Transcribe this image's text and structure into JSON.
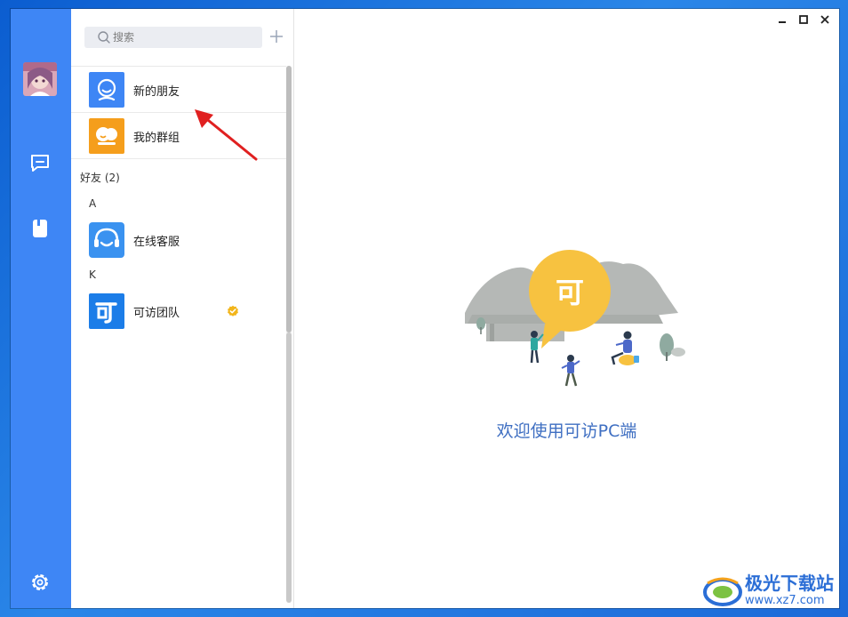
{
  "sidebar": {
    "icons": [
      "avatar",
      "chat-icon",
      "contacts-icon",
      "settings-icon"
    ]
  },
  "search": {
    "placeholder": "搜索"
  },
  "contacts": {
    "top_items": [
      {
        "label": "新的朋友",
        "icon": "new-friend-icon"
      },
      {
        "label": "我的群组",
        "icon": "my-groups-icon"
      }
    ],
    "friends_header": "好友 (2)",
    "sections": [
      {
        "letter": "A",
        "items": [
          {
            "label": "在线客服",
            "icon": "customer-service-icon"
          }
        ]
      },
      {
        "letter": "K",
        "items": [
          {
            "label": "可访团队",
            "icon": "kefang-team-icon",
            "verified": true
          }
        ]
      }
    ]
  },
  "main": {
    "welcome": "欢迎使用可访PC端",
    "bubble_text": "可"
  },
  "watermark": {
    "line1": "极光下载站",
    "line2": "www.xz7.com"
  },
  "colors": {
    "rail": "#3e86f5",
    "new_friend_icon_bg": "#3e86f5",
    "groups_icon_bg": "#f59e1c",
    "welcome_text": "#3f6fc2",
    "bubble": "#f7c240",
    "annotation_arrow": "#e02020"
  }
}
